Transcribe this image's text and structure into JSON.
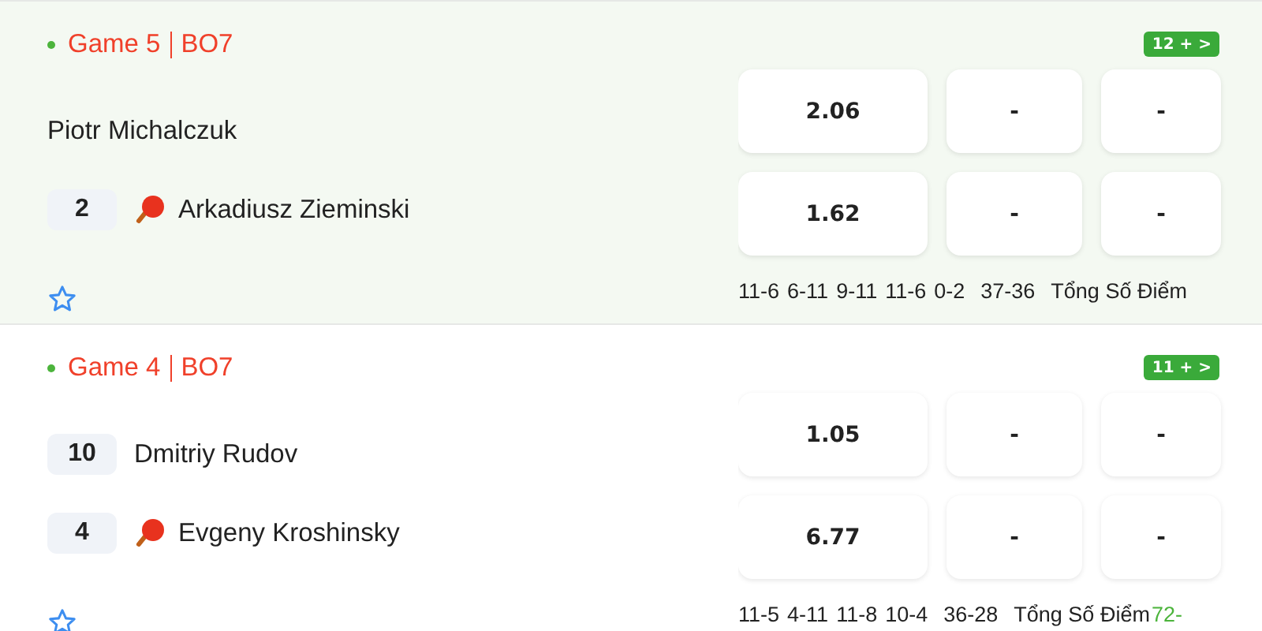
{
  "matches": [
    {
      "highlighted": true,
      "live": true,
      "game": "Game 5",
      "series": "BO7",
      "more_markets": "12 + >",
      "players": [
        {
          "name": "Piotr Michalczuk",
          "serving": false,
          "odds": [
            "2.06",
            "-",
            "-"
          ]
        },
        {
          "score": "2",
          "name": "Arkadiusz Zieminski",
          "serving": true,
          "odds": [
            "1.62",
            "-",
            "-"
          ]
        }
      ],
      "favorite": false,
      "set_scores": [
        "11-6",
        "6-11",
        "9-11",
        "11-6",
        "0-2"
      ],
      "total": "37-36",
      "total_label": "Tổng Số Điểm"
    },
    {
      "highlighted": false,
      "live": true,
      "game": "Game 4",
      "series": "BO7",
      "more_markets": "11 + >",
      "players": [
        {
          "score": "10",
          "name": "Dmitriy Rudov",
          "serving": false,
          "odds": [
            "1.05",
            "-",
            "-"
          ]
        },
        {
          "score": "4",
          "name": "Evgeny Kroshinsky",
          "serving": true,
          "odds": [
            "6.77",
            "-",
            "-"
          ]
        }
      ],
      "favorite": false,
      "set_scores": [
        "11-5",
        "4-11",
        "11-8",
        "10-4"
      ],
      "total": "36-28",
      "total_label": "Tổng Số Điểm",
      "total_points": "72-"
    }
  ]
}
